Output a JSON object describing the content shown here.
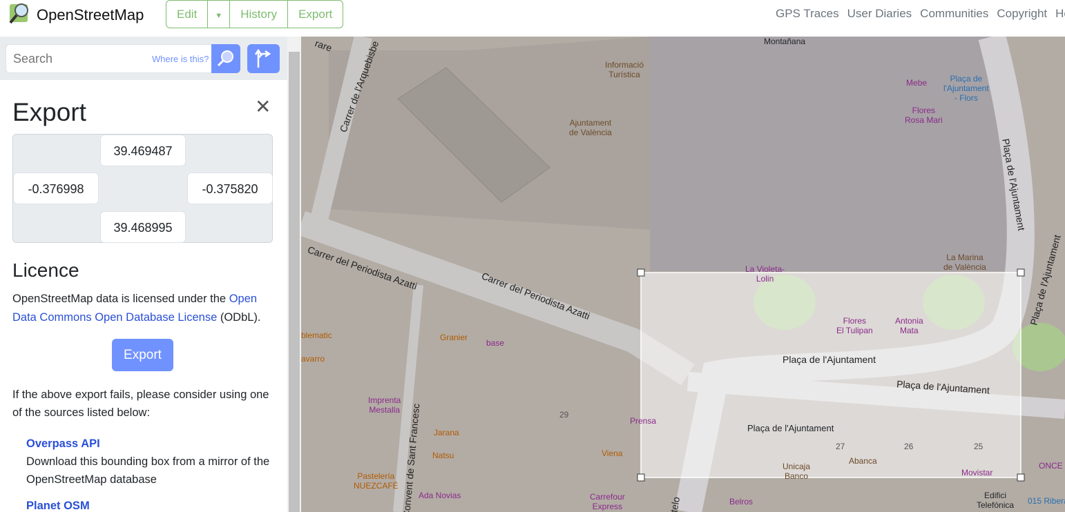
{
  "header": {
    "brand": "OpenStreetMap",
    "nav": {
      "edit": "Edit",
      "history": "History",
      "export": "Export"
    },
    "right_links": [
      "GPS Traces",
      "User Diaries",
      "Communities",
      "Copyright",
      "He"
    ]
  },
  "search": {
    "placeholder": "Search",
    "where": "Where is this?"
  },
  "export": {
    "title": "Export",
    "north": "39.469487",
    "west": "-0.376998",
    "east": "-0.375820",
    "south": "39.468995",
    "licence_title": "Licence",
    "licence_pre": "OpenStreetMap data is licensed under the ",
    "licence_link": "Open Data Commons Open Database License",
    "licence_post": " (ODbL).",
    "button": "Export",
    "fail": "If the above export fails, please consider using one of the sources listed below:",
    "sources": [
      {
        "name": "Overpass API",
        "desc": "Download this bounding box from a mirror of the OpenStreetMap database"
      },
      {
        "name": "Planet OSM",
        "desc": ""
      }
    ]
  },
  "map": {
    "labels": [
      {
        "t": "Montañana",
        "c": "#333"
      },
      {
        "t": "Informació\nTurística",
        "c": "#6b4a2a"
      },
      {
        "t": "Ajuntament\nde València",
        "c": "#6b4a2a"
      },
      {
        "t": "Mebe",
        "c": "#8a2a8a"
      },
      {
        "t": "Plaça de\nl'Ajuntament\n- Flors",
        "c": "#2a6fb0"
      },
      {
        "t": "Flores\nRosa Mari",
        "c": "#8a2a8a"
      },
      {
        "t": "La Marina\nde València",
        "c": "#6b4a2a"
      },
      {
        "t": "La Violeta-\nLolin",
        "c": "#8a2a8a"
      },
      {
        "t": "Flores\nEl Tulipan",
        "c": "#8a2a8a"
      },
      {
        "t": "Antonia\nMata",
        "c": "#8a2a8a"
      },
      {
        "t": "Granier",
        "c": "#b05a00"
      },
      {
        "t": "base",
        "c": "#8a2a8a"
      },
      {
        "t": "Imprenta\nMestalla",
        "c": "#8a2a8a"
      },
      {
        "t": "Jarana",
        "c": "#b05a00"
      },
      {
        "t": "Natsu",
        "c": "#b05a00"
      },
      {
        "t": "Pastelería\nNUEZCAFÉ",
        "c": "#b05a00"
      },
      {
        "t": "Ada Novias",
        "c": "#8a2a8a"
      },
      {
        "t": "Prensa",
        "c": "#8a2a8a"
      },
      {
        "t": "Viena",
        "c": "#b05a00"
      },
      {
        "t": "Carrefour\nExpress",
        "c": "#8a2a8a"
      },
      {
        "t": "Unicaja\nBanco",
        "c": "#6b4a2a"
      },
      {
        "t": "Abanca",
        "c": "#6b4a2a"
      },
      {
        "t": "Movistar",
        "c": "#8a2a8a"
      },
      {
        "t": "ONCE",
        "c": "#8a2a8a"
      },
      {
        "t": "015 Ribera",
        "c": "#2a6fb0"
      },
      {
        "t": "Edifici\nTelefónica",
        "c": "#333"
      },
      {
        "t": "Belros",
        "c": "#8a2a8a"
      },
      {
        "t": "blematic",
        "c": "#b05a00"
      },
      {
        "t": "avarro",
        "c": "#b05a00"
      },
      {
        "t": "29",
        "c": "#555"
      },
      {
        "t": "27",
        "c": "#555"
      },
      {
        "t": "26",
        "c": "#555"
      },
      {
        "t": "25",
        "c": "#555"
      }
    ],
    "streets": [
      "Carrer del Periodista Azatti",
      "Carrer del Periodista Azatti",
      "Plaça de l'Ajuntament",
      "Plaça de l'Ajuntament",
      "Plaça de l'Ajuntament",
      "Carrer de l'Arquebisbe",
      "Convent de Sant Francesc",
      "Plaça de l'Ajuntament",
      "Plaça de l'Ajuntament",
      "rare",
      "otelo"
    ]
  }
}
